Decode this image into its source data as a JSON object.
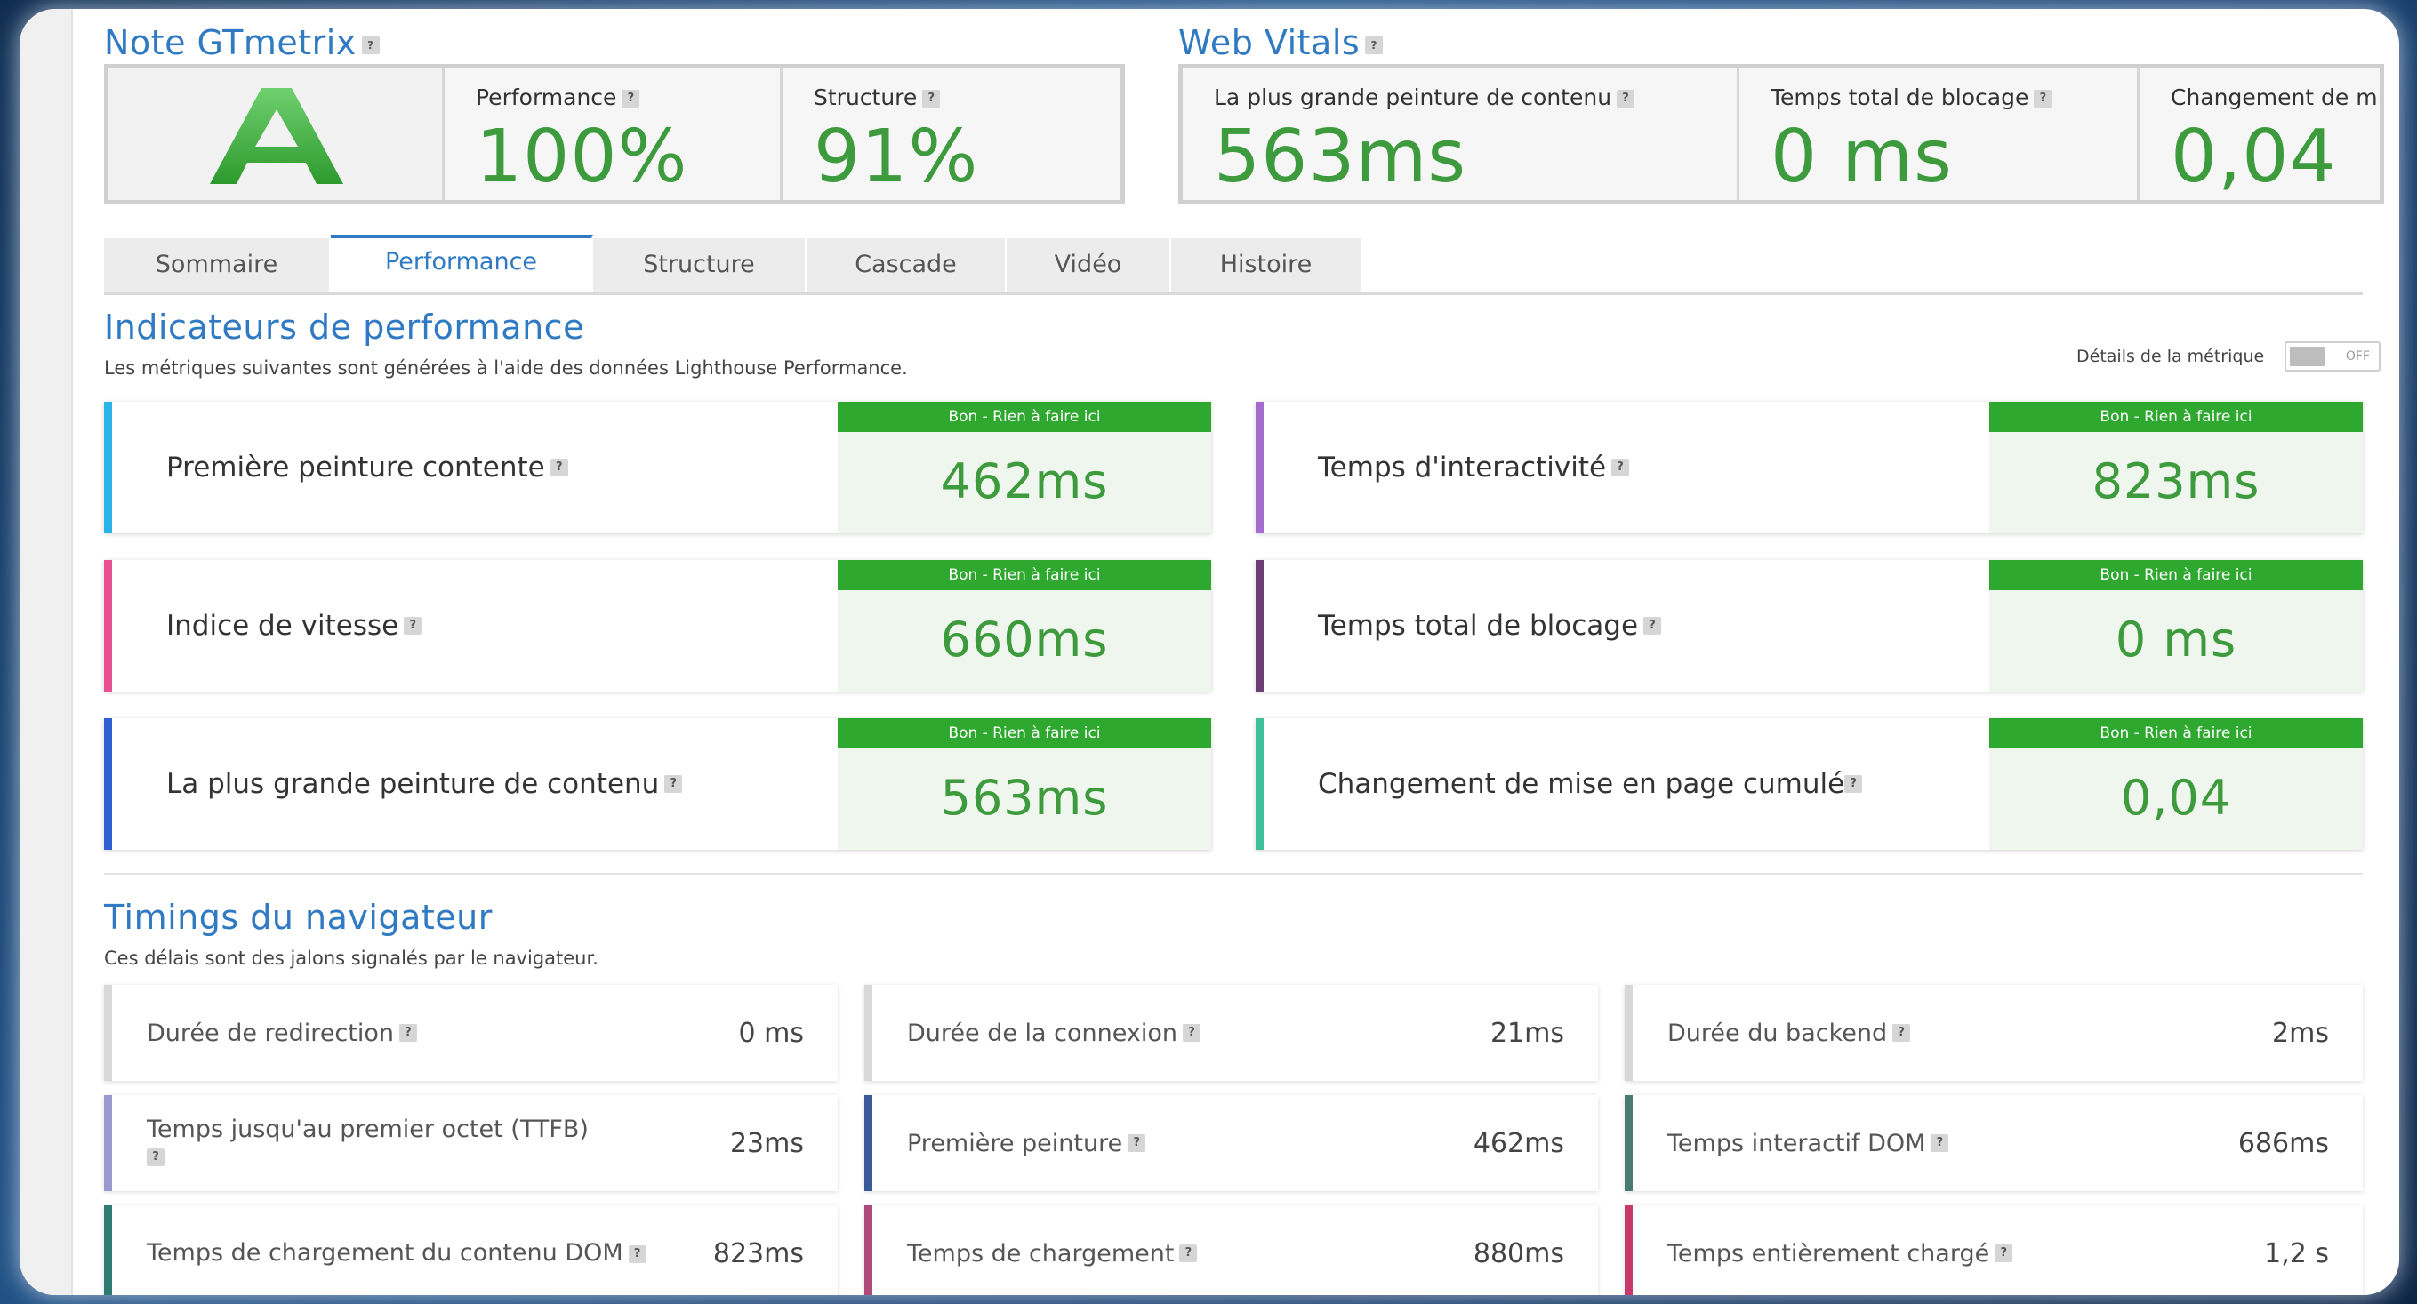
{
  "grade_section": {
    "title": "Note GTmetrix",
    "grade": "A",
    "items": [
      {
        "label": "Performance",
        "value": "100%"
      },
      {
        "label": "Structure",
        "value": "91%"
      }
    ]
  },
  "web_vitals": {
    "title": "Web Vitals",
    "items": [
      {
        "label": "La plus grande peinture de contenu",
        "value": "563ms"
      },
      {
        "label": "Temps total de blocage",
        "value": "0 ms"
      },
      {
        "label": "Changement de mi",
        "value": "0,04"
      }
    ]
  },
  "tabs": [
    "Sommaire",
    "Performance",
    "Structure",
    "Cascade",
    "Vidéo",
    "Histoire"
  ],
  "active_tab": "Performance",
  "performance": {
    "title": "Indicateurs de performance",
    "subtitle": "Les métriques suivantes sont générées à l'aide des données Lighthouse Performance.",
    "toggle_label": "Détails de la métrique",
    "toggle_state": "OFF",
    "metrics": [
      {
        "name": "Première peinture contente",
        "grade": "Bon - Rien à faire ici",
        "value": "462ms",
        "color": "#2bb3e8"
      },
      {
        "name": "Temps d'interactivité",
        "grade": "Bon - Rien à faire ici",
        "value": "823ms",
        "color": "#a46ccf"
      },
      {
        "name": "Indice de vitesse",
        "grade": "Bon - Rien à faire ici",
        "value": "660ms",
        "color": "#e8508f"
      },
      {
        "name": "Temps total de blocage",
        "grade": "Bon - Rien à faire ici",
        "value": "0 ms",
        "color": "#6b3f73"
      },
      {
        "name": "La plus grande peinture de contenu",
        "grade": "Bon - Rien à faire ici",
        "value": "563ms",
        "color": "#2f5fd0"
      },
      {
        "name": "Changement de mise en page cumulé",
        "grade": "Bon - Rien à faire ici",
        "value": "0,04",
        "color": "#3fbf9a"
      }
    ]
  },
  "timings": {
    "title": "Timings du navigateur",
    "subtitle": "Ces délais sont des jalons signalés par le navigateur.",
    "items": [
      {
        "name": "Durée de redirection",
        "value": "0 ms",
        "color": "#d8d8d8"
      },
      {
        "name": "Durée de la connexion",
        "value": "21ms",
        "color": "#d8d8d8"
      },
      {
        "name": "Durée du backend",
        "value": "2ms",
        "color": "#d8d8d8"
      },
      {
        "name": "Temps jusqu'au premier octet (TTFB)",
        "value": "23ms",
        "color": "#9a9ad0"
      },
      {
        "name": "Première peinture",
        "value": "462ms",
        "color": "#3a5a9a"
      },
      {
        "name": "Temps interactif DOM",
        "value": "686ms",
        "color": "#4a7a74"
      },
      {
        "name": "Temps de chargement du contenu DOM",
        "value": "823ms",
        "color": "#2f7a72"
      },
      {
        "name": "Temps de chargement",
        "value": "880ms",
        "color": "#b04a7a"
      },
      {
        "name": "Temps entièrement chargé",
        "value": "1,2 s",
        "color": "#c8386a"
      }
    ]
  },
  "help_icon": "?"
}
